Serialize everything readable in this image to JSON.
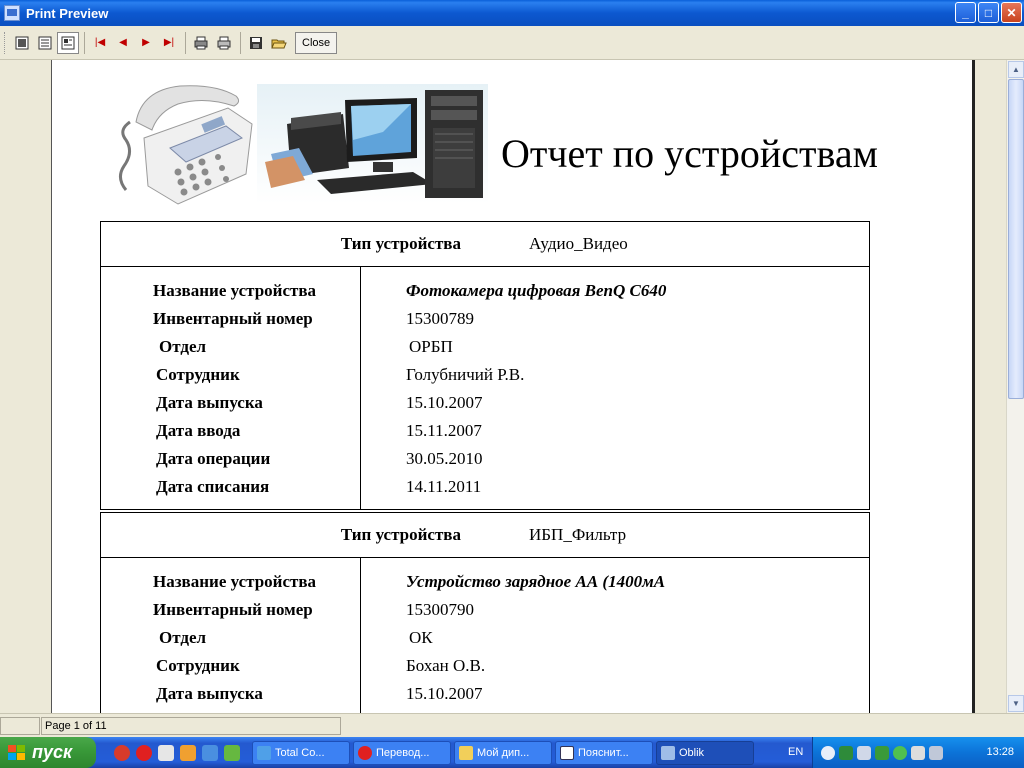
{
  "window": {
    "title": "Print Preview",
    "buttons": {
      "minimize": "_",
      "maximize": "□",
      "close": "✕"
    }
  },
  "toolbar": {
    "close_label": "Close"
  },
  "report": {
    "title": "Отчет по устройствам",
    "groups": [
      {
        "type_label": "Тип устройства",
        "type_value": "Аудио_Видео",
        "fields": [
          {
            "label": "Название устройства",
            "value": "Фотокамера цифровая BenQ C640"
          },
          {
            "label": "Инвентарный номер",
            "value": "15300789"
          },
          {
            "label": "Отдел",
            "value": "ОРБП"
          },
          {
            "label": "Сотрудник",
            "value": "Голубничий Р.В."
          },
          {
            "label": "Дата выпуска",
            "value": "15.10.2007"
          },
          {
            "label": "Дата ввода",
            "value": "15.11.2007"
          },
          {
            "label": "Дата операции",
            "value": "30.05.2010"
          },
          {
            "label": "Дата списания",
            "value": "14.11.2011"
          }
        ]
      },
      {
        "type_label": "Тип устройства",
        "type_value": "ИБП_Фильтр",
        "fields": [
          {
            "label": "Название устройства",
            "value": "Устройство зарядное АА (1400мА"
          },
          {
            "label": "Инвентарный номер",
            "value": "15300790"
          },
          {
            "label": "Отдел",
            "value": "ОК"
          },
          {
            "label": "Сотрудник",
            "value": "Бохан О.В."
          },
          {
            "label": "Дата выпуска",
            "value": "15.10.2007"
          }
        ]
      }
    ]
  },
  "status": {
    "page": "Page 1 of 11"
  },
  "taskbar": {
    "start_label": "пуск",
    "tasks": [
      {
        "label": "Total Co..."
      },
      {
        "label": "Перевод..."
      },
      {
        "label": "Мой дип..."
      },
      {
        "label": "Пояснит..."
      },
      {
        "label": "Oblik"
      }
    ],
    "language": "EN",
    "clock": "13:28"
  },
  "colors": {
    "titlebar": "#0a5fd8",
    "taskbar": "#245dd8",
    "start": "#3a9a3a",
    "nav_arrows": "#c00000"
  }
}
